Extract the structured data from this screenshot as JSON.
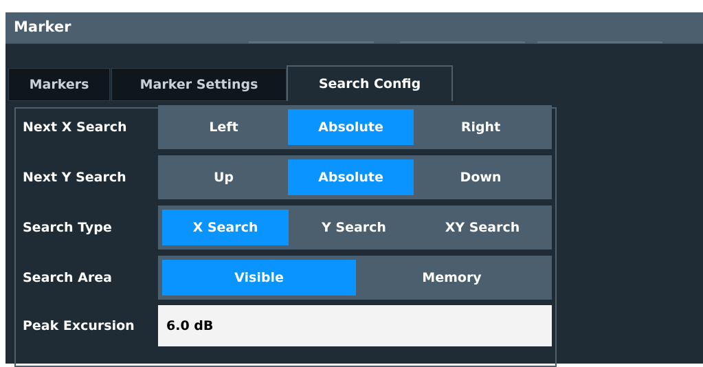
{
  "dialog": {
    "title": "Marker"
  },
  "tabs": [
    {
      "label": "Markers",
      "active": false
    },
    {
      "label": "Marker Settings",
      "active": false
    },
    {
      "label": "Search Config",
      "active": true
    }
  ],
  "rows": {
    "next_x": {
      "label": "Next X Search",
      "options": [
        "Left",
        "Absolute",
        "Right"
      ],
      "selected": "Absolute"
    },
    "next_y": {
      "label": "Next Y Search",
      "options": [
        "Up",
        "Absolute",
        "Down"
      ],
      "selected": "Absolute"
    },
    "search_type": {
      "label": "Search Type",
      "options": [
        "X Search",
        "Y Search",
        "XY Search"
      ],
      "selected": "X Search"
    },
    "search_area": {
      "label": "Search Area",
      "options": [
        "Visible",
        "Memory"
      ],
      "selected": "Visible"
    },
    "peak_excursion": {
      "label": "Peak Excursion",
      "value": "6.0 dB"
    }
  },
  "colors": {
    "selected": "#0a94ff",
    "segment_bg": "#4b5f6e",
    "panel_bg": "#1f2c35",
    "titlebar_bg": "#4b5f6e"
  }
}
